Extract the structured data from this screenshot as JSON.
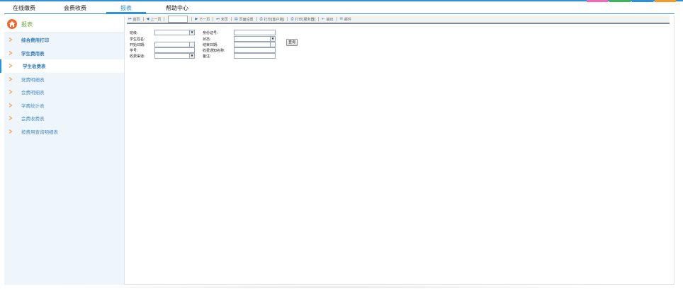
{
  "colors": {
    "accent": "#2f8fd8",
    "sidebar_title": "#6aaa33",
    "sidebar_link": "#4d8fc7",
    "home_icon": "#f26b2a",
    "top_blocks": [
      "#f06ab4",
      "#41b25c",
      "#2f8fd8",
      "#f39a2c"
    ]
  },
  "topnav": {
    "tabs": [
      {
        "label": "在线缴费",
        "active": false
      },
      {
        "label": "会费收费",
        "active": false
      },
      {
        "label": "报表",
        "active": true
      },
      {
        "label": "帮助中心",
        "active": false
      }
    ]
  },
  "sidebar": {
    "title": "报表",
    "items": [
      {
        "label": "综合费用打印",
        "bold": true,
        "active": false
      },
      {
        "label": "学生费用表",
        "bold": true,
        "active": false
      },
      {
        "label": "学生收费表",
        "bold": true,
        "active": true
      },
      {
        "label": "党费明细表",
        "bold": false,
        "active": false
      },
      {
        "label": "会费明细表",
        "bold": false,
        "active": false
      },
      {
        "label": "学费统计表",
        "bold": false,
        "active": false
      },
      {
        "label": "会费收费表",
        "bold": false,
        "active": false
      },
      {
        "label": "按费用查询明细表",
        "bold": false,
        "active": false
      }
    ]
  },
  "toolbar": {
    "first": "首页",
    "prev": "上一页",
    "next": "下一页",
    "last": "末页",
    "page_setup": "页面设置",
    "print_client": "打印[客户端]",
    "print_server": "打印[服务器]",
    "export": "输出",
    "mail": "邮件",
    "page_value": ""
  },
  "form": {
    "class_label": "班级:",
    "id_label": "身份证号:",
    "name_label": "学生姓名:",
    "status_label": "状态:",
    "start_label": "开始日期:",
    "end_label": "结束日期:",
    "stuno_label": "学号:",
    "notice_label": "收费通知名称:",
    "channel_label": "收费渠道:",
    "remark_label": "备注:",
    "query_button": "查询"
  }
}
